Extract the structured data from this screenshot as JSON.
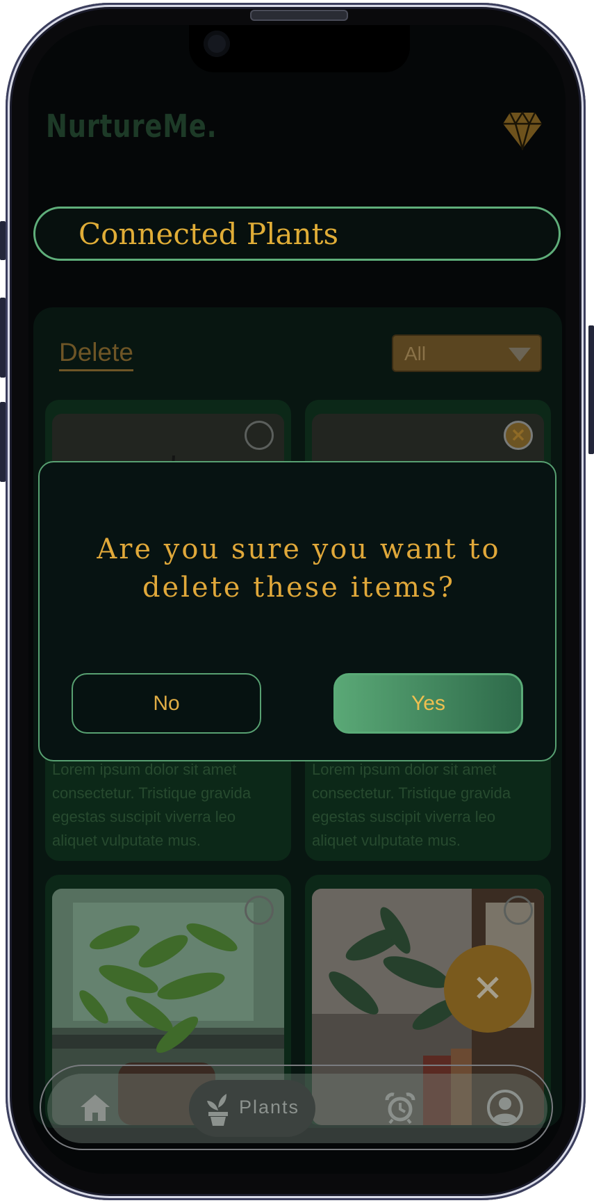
{
  "app": {
    "logo": "NurtureMe.",
    "page_title": "Connected Plants"
  },
  "toolbar": {
    "delete_label": "Delete",
    "filter_value": "All"
  },
  "cards": [
    {
      "description": "Lorem ipsum dolor sit amet consectetur. Tristique gravida egestas suscipit viverra leo aliquet vulputate mus.",
      "selected": false
    },
    {
      "description": "Lorem ipsum dolor sit amet consectetur. Tristique gravida egestas suscipit viverra leo aliquet vulputate mus.",
      "selected": true
    },
    {
      "selected": false
    },
    {
      "selected": false
    }
  ],
  "dialog": {
    "question": "Are you sure you want to delete these items?",
    "no_label": "No",
    "yes_label": "Yes"
  },
  "nav": {
    "home_icon": "home-icon",
    "plants_label": "Plants",
    "alarm_icon": "alarm-clock-icon",
    "profile_icon": "user-circle-icon"
  },
  "colors": {
    "accent_gold": "#e0ad37",
    "accent_green": "#5fae7a",
    "background": "#050708"
  }
}
